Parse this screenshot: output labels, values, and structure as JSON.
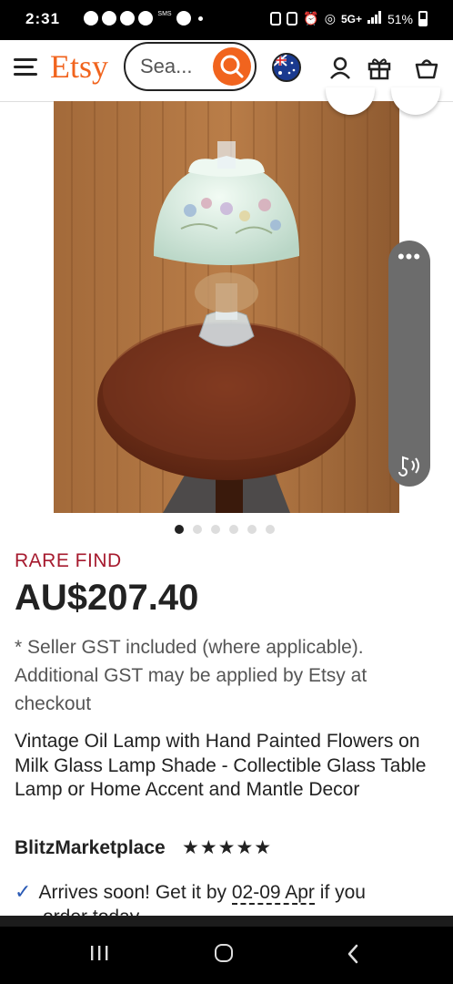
{
  "status_bar": {
    "time": "2:31",
    "network_label": "5G+",
    "battery_text": "51%",
    "tiny_label": "SMS"
  },
  "header": {
    "logo_text": "Etsy",
    "search_placeholder": "Sea...",
    "accent_color": "#f1641e"
  },
  "gallery": {
    "image_count": 6,
    "active_index": 0
  },
  "listing": {
    "badge": "RARE FIND",
    "price": "AU$207.40",
    "gst_note": "* Seller GST included (where applicable). Additional GST may be applied by Etsy at checkout",
    "title": "Vintage Oil Lamp with Hand Painted Flowers on Milk Glass Lamp Shade - Collectible Glass Table Lamp or Home Accent and Mantle Decor",
    "shop_name": "BlitzMarketplace",
    "rating_stars": "★★★★★",
    "rating_value": 5,
    "delivery_prefix": "Arrives soon! Get it by ",
    "delivery_date": "02-09 Apr",
    "delivery_suffix": " if you",
    "delivery_cut": "order today"
  },
  "icons": [
    "menu-icon",
    "search-icon",
    "flag-au-icon",
    "account-icon",
    "gift-icon",
    "cart-icon",
    "checkmark-icon",
    "more-icon",
    "audio-icon"
  ]
}
